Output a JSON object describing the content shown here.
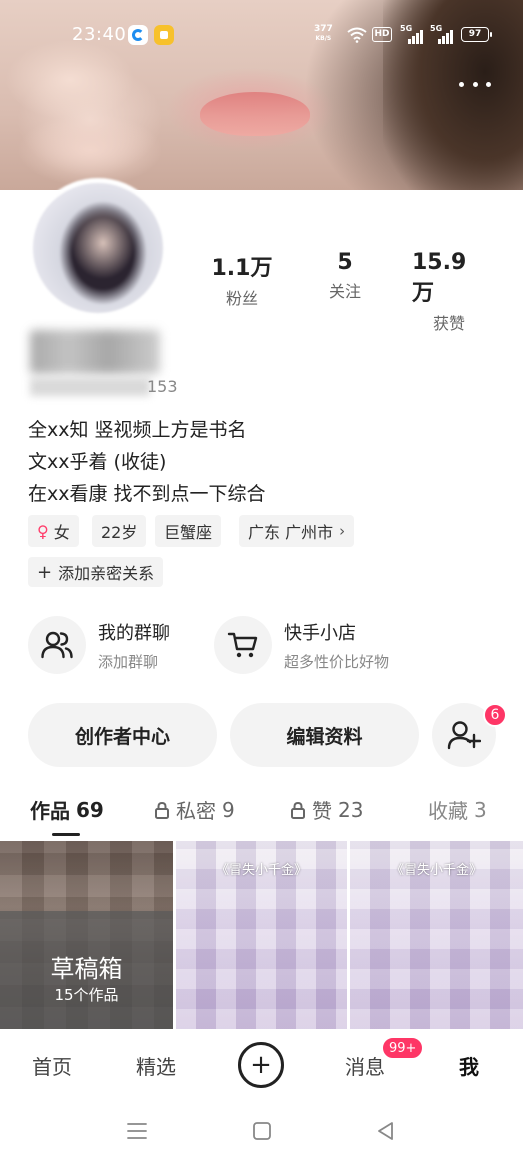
{
  "status_bar": {
    "time": "23:40",
    "net_speed_value": "377",
    "net_speed_unit": "KB/S",
    "hd_label": "HD",
    "signal_1_label": "5G",
    "signal_2_label": "5G",
    "battery": "97"
  },
  "profile": {
    "stats": [
      {
        "value": "1.1万",
        "label": "粉丝"
      },
      {
        "value": "5",
        "label": "关注"
      },
      {
        "value": "15.9万",
        "label": "获赞"
      }
    ],
    "id_suffix": "153",
    "bio": [
      "全xx知 竖视频上方是书名",
      "文xx乎着 (收徒)",
      "在xx看康 找不到点一下综合"
    ],
    "tags": {
      "gender": "女",
      "age": "22岁",
      "zodiac": "巨蟹座",
      "region": "广东 广州市"
    },
    "add_relation": "添加亲密关系"
  },
  "features": {
    "group_title": "我的群聊",
    "group_sub": "添加群聊",
    "shop_title": "快手小店",
    "shop_sub": "超多性价比好物"
  },
  "actions": {
    "creator": "创作者中心",
    "edit": "编辑资料",
    "friend_badge": "6"
  },
  "tabs": {
    "works": "作品",
    "works_count": "69",
    "private": "私密",
    "private_count": "9",
    "likes": "赞",
    "likes_count": "23",
    "favorites": "收藏",
    "favorites_count": "3"
  },
  "grid": {
    "draft_title": "草稿箱",
    "draft_count": "15个作品",
    "thumb_2_title": "《冒失小千金》",
    "thumb_3_title": "《冒失小千金》"
  },
  "bottom_nav": {
    "home": "首页",
    "featured": "精选",
    "create": "+",
    "messages": "消息",
    "messages_badge": "99+",
    "me": "我"
  },
  "colors": {
    "accent_pink": "#fe3666",
    "venus_pink": "#ff3d6b",
    "chip_bg": "#f3f3f3"
  }
}
